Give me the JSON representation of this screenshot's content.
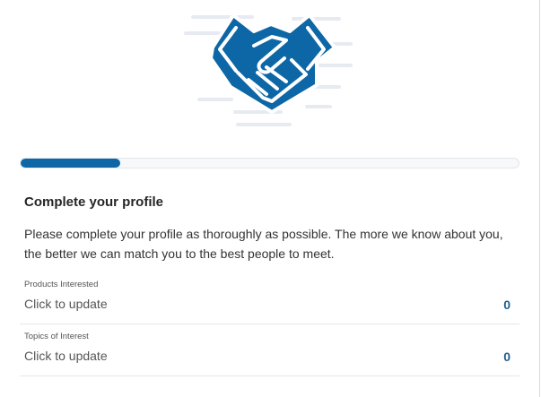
{
  "profile": {
    "title": "Complete your profile",
    "description": "Please complete your profile as thoroughly as possible. The more we know about you, the better we can match you to the best people to meet.",
    "progress_fraction": 0.2
  },
  "fields": [
    {
      "label": "Products Interested",
      "value": "Click to update",
      "count": "0"
    },
    {
      "label": "Topics of Interest",
      "value": "Click to update",
      "count": "0"
    }
  ],
  "colors": {
    "accent": "#0d66a6",
    "illustration_lines": "#e8eaf2"
  },
  "icons": {
    "hero": "handshake-icon"
  }
}
